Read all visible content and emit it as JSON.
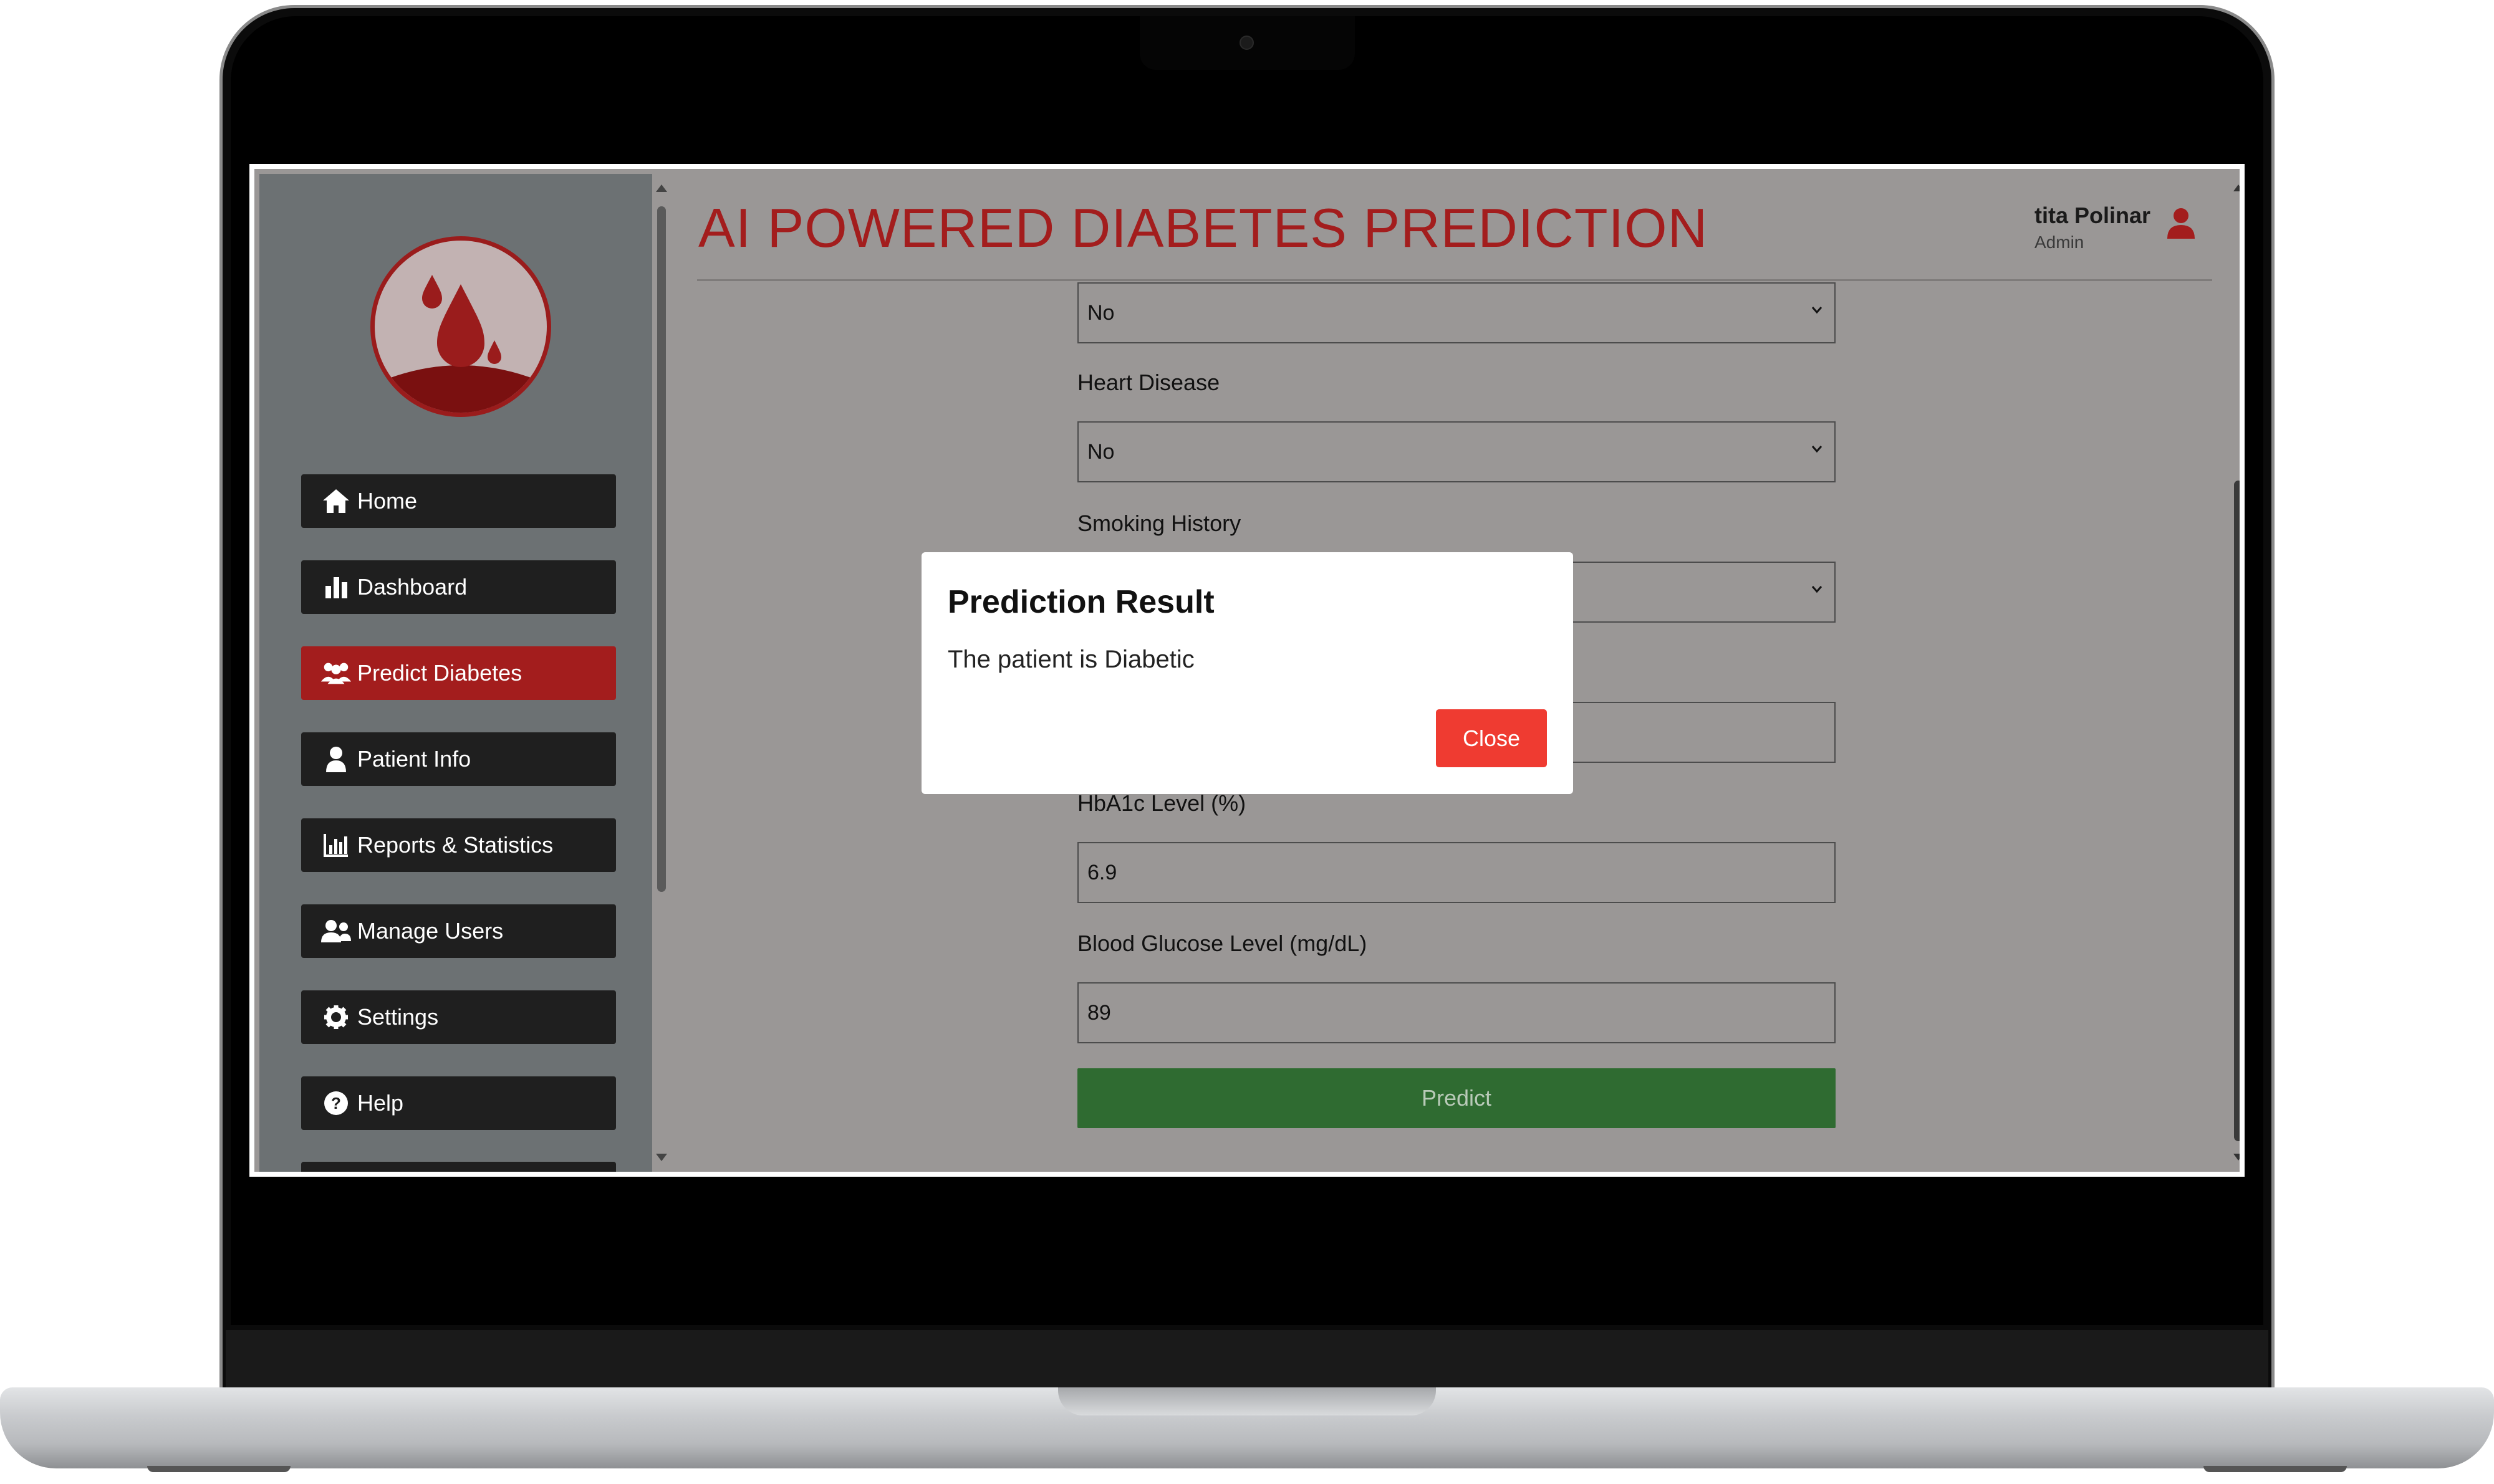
{
  "app": {
    "title": "AI POWERED DIABETES PREDICTION"
  },
  "user": {
    "name": "tita Polinar",
    "role": "Admin",
    "icon": "user-icon"
  },
  "sidebar": {
    "logo_icon": "blood-drop-logo",
    "items": [
      {
        "label": "Home",
        "icon": "home-icon",
        "active": false
      },
      {
        "label": "Dashboard",
        "icon": "bar-chart-icon",
        "active": false
      },
      {
        "label": "Predict Diabetes",
        "icon": "users-group-icon",
        "active": true
      },
      {
        "label": "Patient Info",
        "icon": "user-icon",
        "active": false
      },
      {
        "label": "Reports & Statistics",
        "icon": "chart-icon",
        "active": false
      },
      {
        "label": "Manage Users",
        "icon": "users-icon",
        "active": false
      },
      {
        "label": "Settings",
        "icon": "gear-icon",
        "active": false
      },
      {
        "label": "Help",
        "icon": "help-icon",
        "active": false
      }
    ]
  },
  "form": {
    "select_top_value": "No",
    "heart_disease": {
      "label": "Heart Disease",
      "value": "No"
    },
    "smoking_history": {
      "label": "Smoking History",
      "value": ""
    },
    "bmi": {
      "value": ""
    },
    "hba1c": {
      "label": "HbA1c Level (%)",
      "value": "6.9"
    },
    "glucose": {
      "label": "Blood Glucose Level (mg/dL)",
      "value": "89"
    },
    "predict_label": "Predict"
  },
  "modal": {
    "title": "Prediction Result",
    "message": "The patient is Diabetic",
    "close_label": "Close"
  },
  "colors": {
    "brand_red": "#a31d1d",
    "predict_green": "#2f6b31",
    "close_red": "#ef3b31",
    "sidebar_bg": "#6c7173"
  }
}
